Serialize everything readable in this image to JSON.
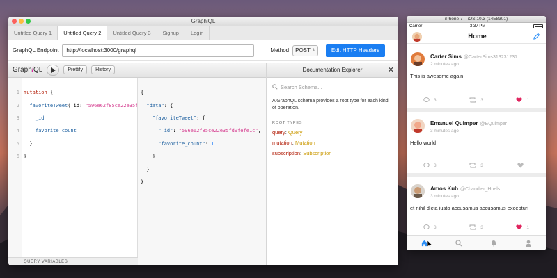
{
  "graphiql": {
    "window_title": "GraphiQL",
    "tabs": [
      {
        "label": "Untitled Query 1"
      },
      {
        "label": "Untitled Query 2"
      },
      {
        "label": "Untitled Query 3"
      },
      {
        "label": "Signup"
      },
      {
        "label": "Login"
      }
    ],
    "active_tab": 1,
    "endpoint_label": "GraphQL Endpoint",
    "endpoint_value": "http://localhost:3000/graphql",
    "method_label": "Method",
    "method_value": "POST",
    "edit_headers_label": "Edit HTTP Headers",
    "toolbar": {
      "logo_pre": "Graph",
      "logo_i": "i",
      "logo_post": "QL",
      "prettify": "Prettify",
      "history": "History"
    },
    "query_lines": [
      {
        "ln": "1",
        "kw": "mutation",
        "rest": " {"
      },
      {
        "ln": "2",
        "fn": "  favoriteTweet",
        "pre": "(_id: ",
        "str": "\"596e62f85ce22e35f"
      },
      {
        "ln": "3",
        "field": "    _id"
      },
      {
        "ln": "4",
        "field": "    favorite_count"
      },
      {
        "ln": "5",
        "plain": "  }"
      },
      {
        "ln": "6",
        "plain": "}"
      }
    ],
    "query_variables_label": "QUERY VARIABLES",
    "result_lines": [
      {
        "plain": "{"
      },
      {
        "key": "  \"data\"",
        "rest": ": {"
      },
      {
        "key": "    \"favoriteTweet\"",
        "rest": ": {"
      },
      {
        "key": "      \"_id\"",
        "rest": ": ",
        "str": "\"596e62f85ce22e35fd9fefe1c\"",
        "tail": ","
      },
      {
        "key": "      \"favorite_count\"",
        "rest": ": ",
        "num": "1"
      },
      {
        "plain": "    }"
      },
      {
        "plain": "  }"
      },
      {
        "plain": "}"
      }
    ],
    "docs": {
      "title": "Documentation Explorer",
      "close": "✕",
      "search_placeholder": "Search Schema...",
      "description": "A GraphQL schema provides a root type for each kind of operation.",
      "root_types_label": "ROOT TYPES",
      "root_types": [
        {
          "key": "query",
          "value": "Query"
        },
        {
          "key": "mutation",
          "value": "Mutation"
        },
        {
          "key": "subscription",
          "value": "Subscription"
        }
      ]
    }
  },
  "simulator": {
    "window_title": "iPhone 7 – iOS 10.3 (14E8301)",
    "carrier": "Carrier",
    "time": "3:37 PM",
    "nav_title": "Home",
    "tweets": [
      {
        "name": "Carter Sims",
        "handle": "@CarterSims313231231",
        "time": "2 minutes ago",
        "text": "This is awesome again",
        "replies": "3",
        "retweets": "3",
        "likes": "1",
        "liked": true
      },
      {
        "name": "Emanuel Quimper",
        "handle": "@EQuimper",
        "time": "3 minutes ago",
        "text": "Hello world",
        "replies": "3",
        "retweets": "3",
        "likes": "",
        "liked": false
      },
      {
        "name": "Amos Kub",
        "handle": "@Chandler_Huels",
        "time": "3 minutes ago",
        "text": "et nihil dicta iusto accusamus accusamus excepturi",
        "replies": "3",
        "retweets": "3",
        "likes": "1",
        "liked": true
      }
    ]
  }
}
